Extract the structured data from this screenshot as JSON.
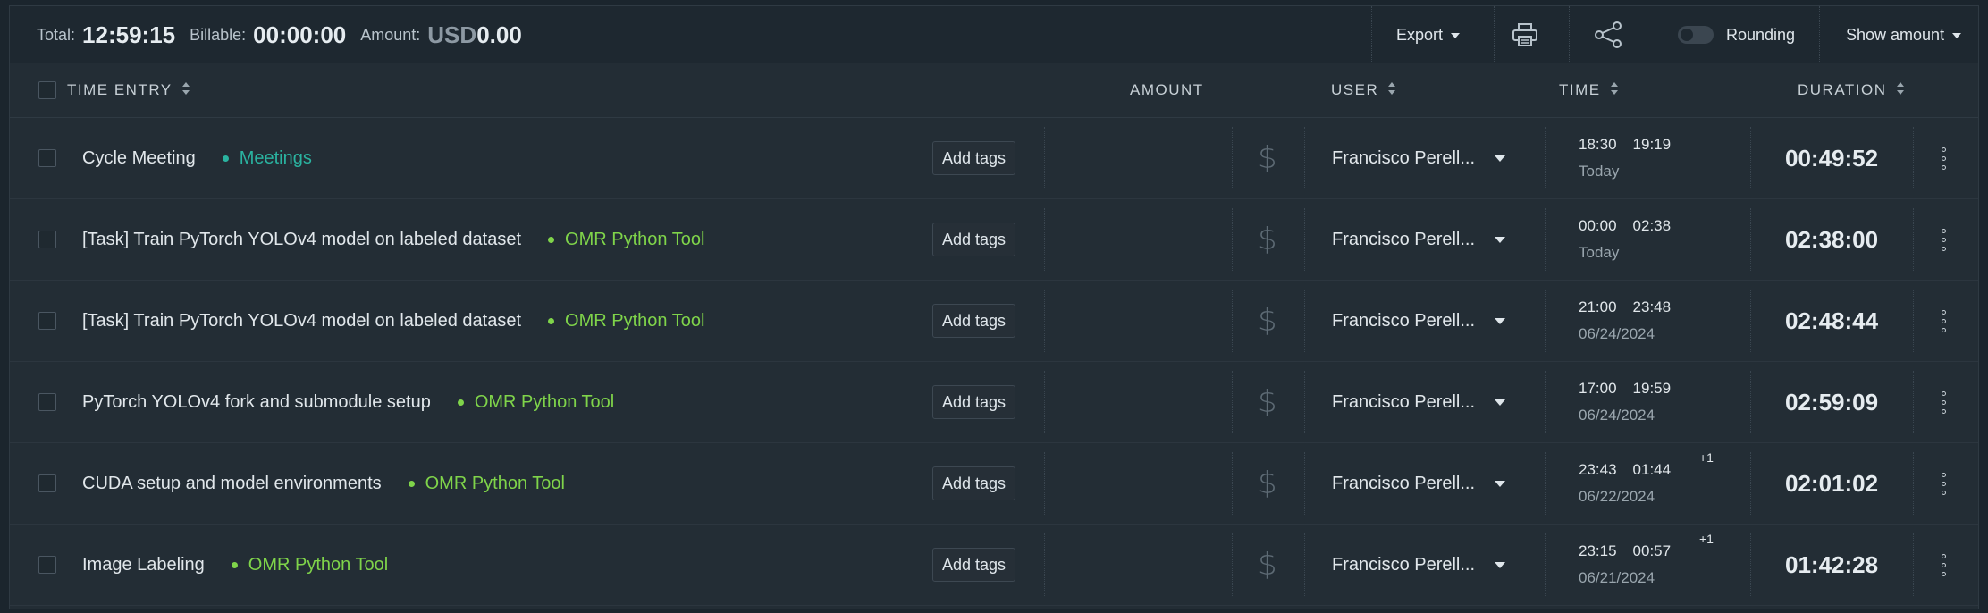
{
  "summary": {
    "total_label": "Total:",
    "total_value": "12:59:15",
    "billable_label": "Billable:",
    "billable_value": "00:00:00",
    "amount_label": "Amount:",
    "amount_currency": "USD",
    "amount_value": "0.00"
  },
  "toolbar": {
    "export_label": "Export",
    "print_icon": "printer-icon",
    "share_icon": "share-icon",
    "rounding_label": "Rounding",
    "rounding_on": false,
    "show_amount_label": "Show amount"
  },
  "columns": {
    "time_entry": "TIME ENTRY",
    "amount": "AMOUNT",
    "user": "USER",
    "time": "TIME",
    "duration": "DURATION"
  },
  "colors": {
    "meetings": "#2ab3a0",
    "omr": "#7fd44a"
  },
  "rows": [
    {
      "description": "Cycle Meeting",
      "project": "Meetings",
      "project_color": "#2ab3a0",
      "tags_label": "Add tags",
      "user": "Francisco Perell...",
      "start": "18:30",
      "end": "19:19",
      "plus": "",
      "date": "Today",
      "duration": "00:49:52"
    },
    {
      "description": "[Task] Train PyTorch YOLOv4 model on labeled dataset",
      "project": "OMR Python Tool",
      "project_color": "#7fd44a",
      "tags_label": "Add tags",
      "user": "Francisco Perell...",
      "start": "00:00",
      "end": "02:38",
      "plus": "",
      "date": "Today",
      "duration": "02:38:00"
    },
    {
      "description": "[Task] Train PyTorch YOLOv4 model on labeled dataset",
      "project": "OMR Python Tool",
      "project_color": "#7fd44a",
      "tags_label": "Add tags",
      "user": "Francisco Perell...",
      "start": "21:00",
      "end": "23:48",
      "plus": "",
      "date": "06/24/2024",
      "duration": "02:48:44"
    },
    {
      "description": "PyTorch YOLOv4 fork and submodule setup",
      "project": "OMR Python Tool",
      "project_color": "#7fd44a",
      "tags_label": "Add tags",
      "user": "Francisco Perell...",
      "start": "17:00",
      "end": "19:59",
      "plus": "",
      "date": "06/24/2024",
      "duration": "02:59:09"
    },
    {
      "description": "CUDA setup and model environments",
      "project": "OMR Python Tool",
      "project_color": "#7fd44a",
      "tags_label": "Add tags",
      "user": "Francisco Perell...",
      "start": "23:43",
      "end": "01:44",
      "plus": "+1",
      "date": "06/22/2024",
      "duration": "02:01:02"
    },
    {
      "description": "Image Labeling",
      "project": "OMR Python Tool",
      "project_color": "#7fd44a",
      "tags_label": "Add tags",
      "user": "Francisco Perell...",
      "start": "23:15",
      "end": "00:57",
      "plus": "+1",
      "date": "06/21/2024",
      "duration": "01:42:28"
    }
  ]
}
